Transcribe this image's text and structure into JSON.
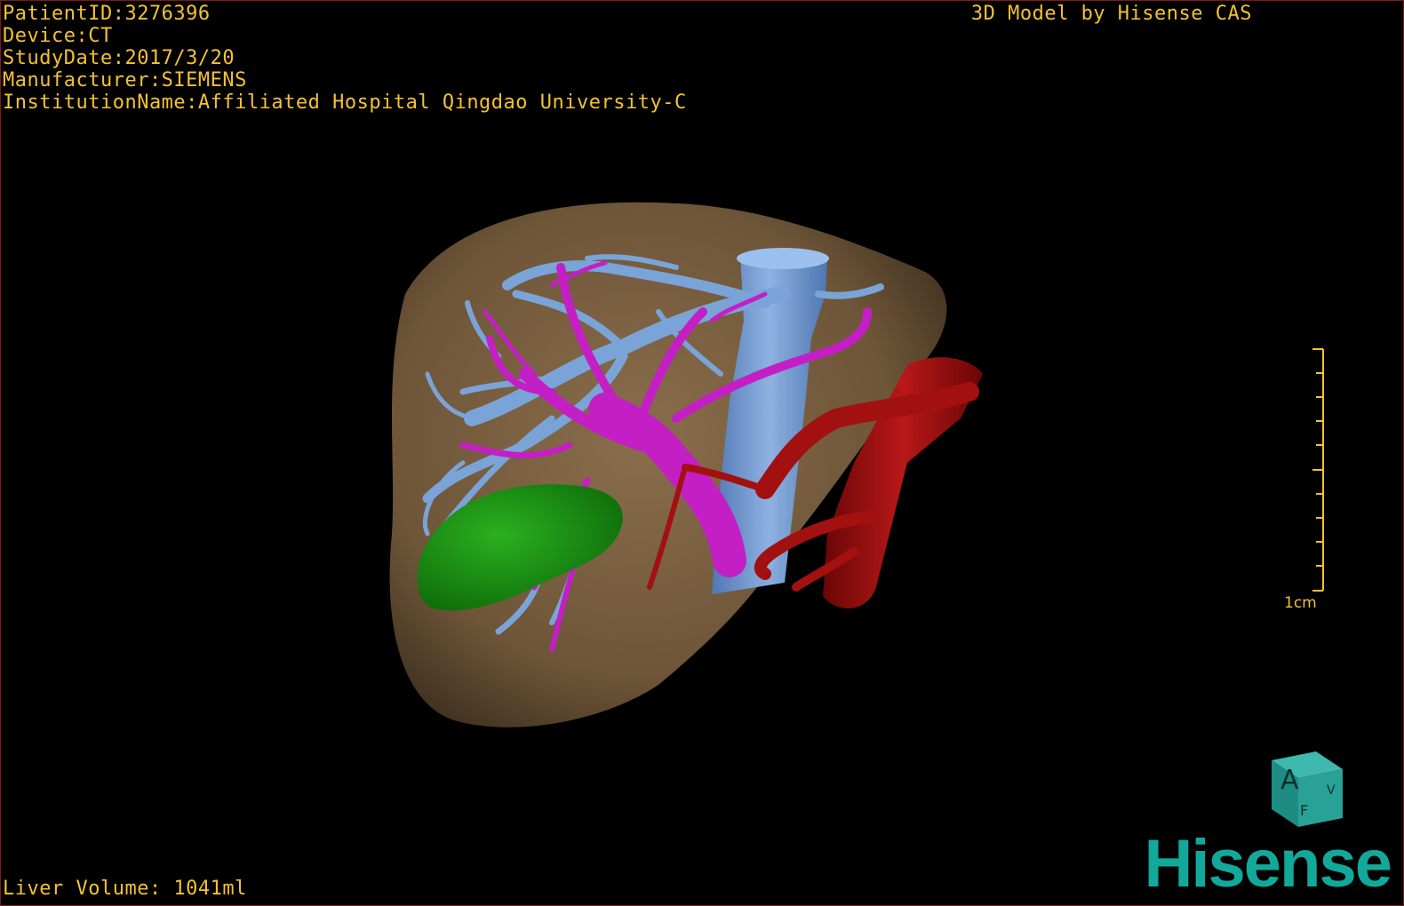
{
  "overlay": {
    "patient_id": "PatientID:3276396",
    "device": "Device:CT",
    "study_date": "StudyDate:2017/3/20",
    "manufacturer": "Manufacturer:SIEMENS",
    "institution": "InstitutionName:Affiliated Hospital Qingdao University-C",
    "model_credit": "3D Model by Hisense CAS",
    "liver_volume": "Liver Volume: 1041ml"
  },
  "scale": {
    "label": "1cm"
  },
  "orientation_cube": {
    "front": "A",
    "side": "V",
    "bottom": "F"
  },
  "brand": {
    "logo_text": "Hisense"
  },
  "colors": {
    "text": "#f2c232",
    "liver": "#7a6043",
    "hepatic_veins": "#7aa4d8",
    "portal_vein": "#c41fc4",
    "tumor": "#1a8a12",
    "artery_aorta": "#a31010",
    "brand": "#12a99b"
  }
}
